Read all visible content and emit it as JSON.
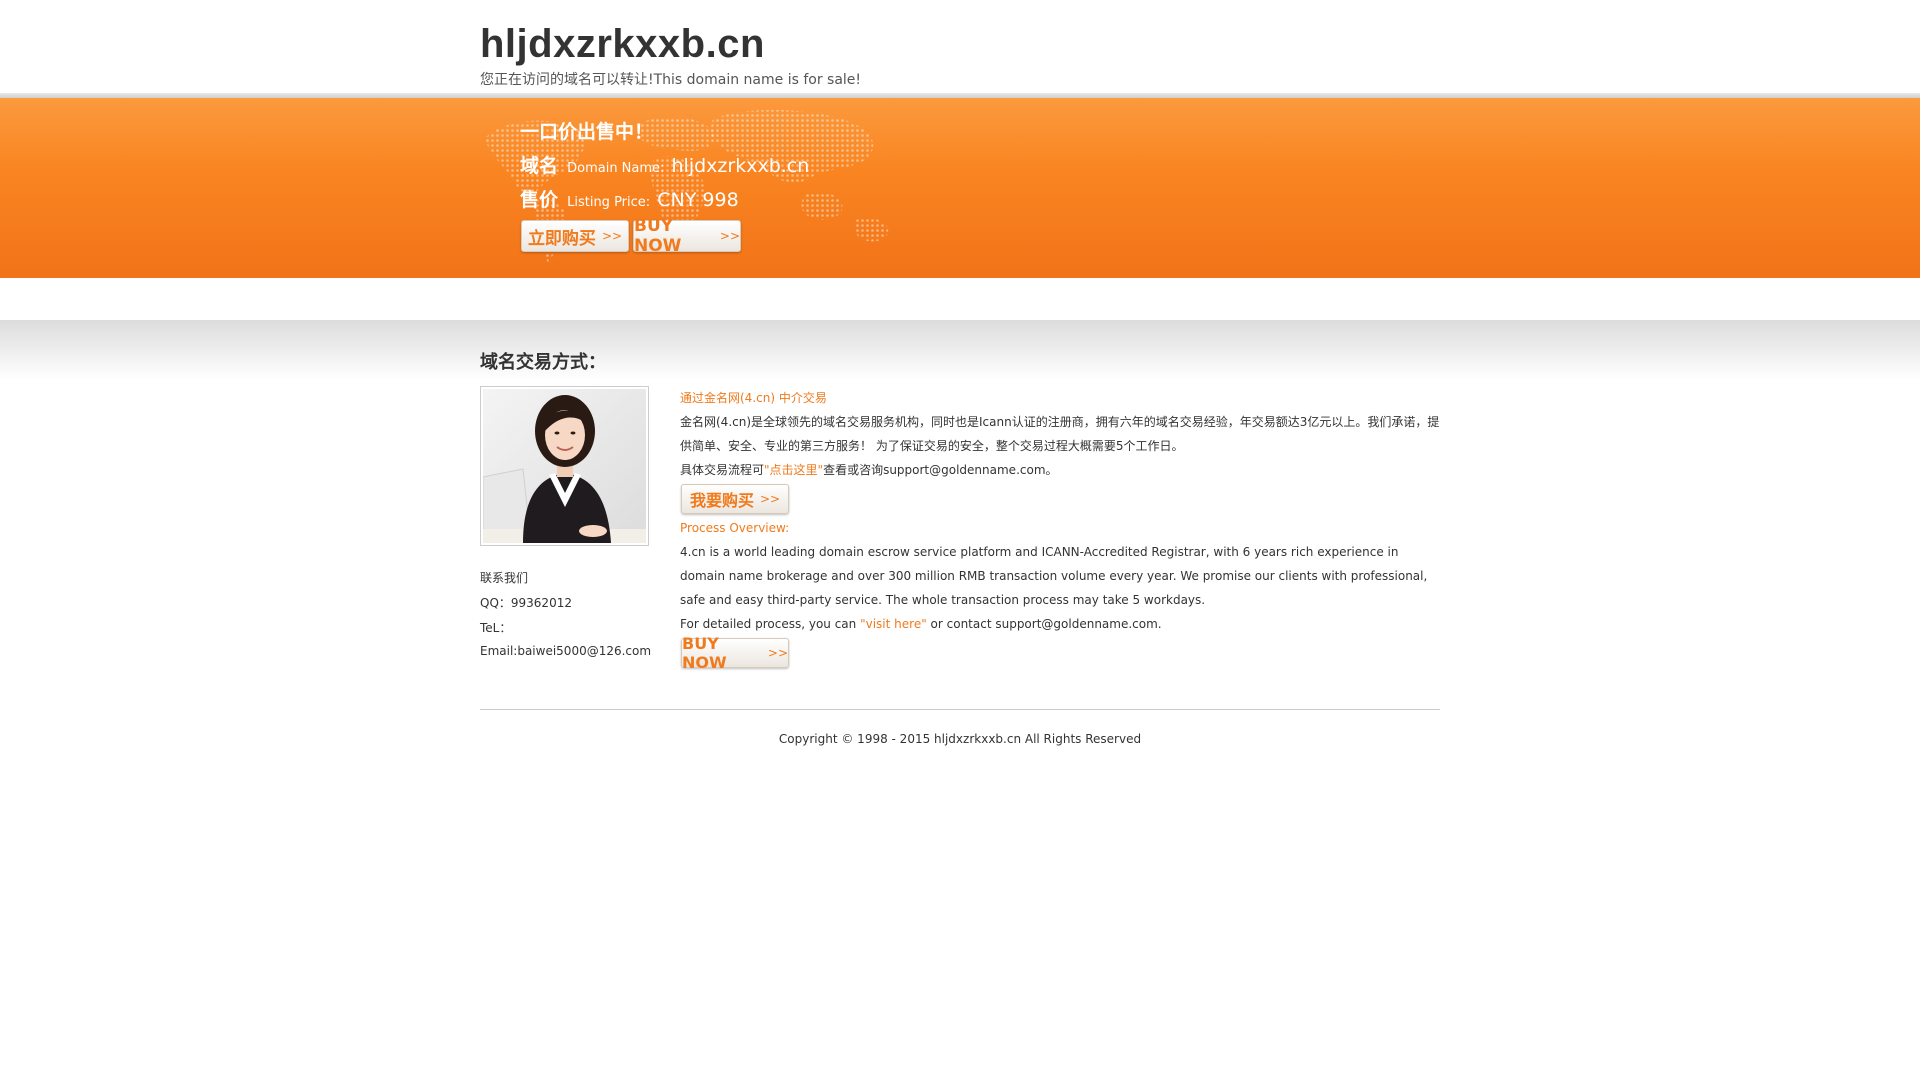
{
  "header": {
    "title": "hljdxzrkxxb.cn",
    "subtitle": "您正在访问的域名可以转让!This domain name is for sale!"
  },
  "banner": {
    "heading": "一口价出售中！",
    "domain_label_cn": "域名",
    "domain_label_en": "Domain Name:",
    "domain_value": "hljdxzrkxxb.cn",
    "price_label_cn": "售价",
    "price_label_en": "Listing Price:",
    "price_value": "CNY 998",
    "buy_cn_label": "立即购买",
    "buy_en_label": "BUY NOW",
    "arrow": ">>"
  },
  "section": {
    "title": "域名交易方式："
  },
  "contact": {
    "heading": "联系我们",
    "qq": "QQ：99362012",
    "tel": "TeL：",
    "email": "Email:baiwei5000@126.com"
  },
  "content": {
    "cn_heading": "通过金名网(4.cn) 中介交易",
    "cn_paragraph": "金名网(4.cn)是全球领先的域名交易服务机构，同时也是Icann认证的注册商，拥有六年的域名交易经验，年交易额达3亿元以上。我们承诺，提供简单、安全、专业的第三方服务！ 为了保证交易的安全，整个交易过程大概需要5个工作日。",
    "cn_detail_prefix": "具体交易流程可",
    "cn_detail_link": "\"点击这里\"",
    "cn_detail_suffix": "查看或咨询support@goldenname.com。",
    "cn_button": "我要购买",
    "en_heading": "Process Overview:",
    "en_paragraph": "4.cn is a world leading domain escrow service platform and ICANN-Accredited Registrar, with 6 years rich experience in domain name brokerage and over 300 million RMB transaction volume every year. We promise our clients with professional, safe and easy third-party service. The whole transaction process may take 5 workdays.",
    "en_detail_prefix": "For detailed process, you can ",
    "en_detail_link": "\"visit here\"",
    "en_detail_suffix": " or contact support@goldenname.com.",
    "en_button": "BUY NOW"
  },
  "footer": {
    "copyright": "Copyright © 1998 - 2015 hljdxzrkxxb.cn All Rights Reserved"
  },
  "colors": {
    "accent": "#f07a1c",
    "banner_top": "#fb9a3e",
    "banner_bottom": "#f27318",
    "text": "#333333"
  },
  "icons": {
    "world_map": "world-map-dots",
    "photo": "customer-service-agent-photo"
  }
}
